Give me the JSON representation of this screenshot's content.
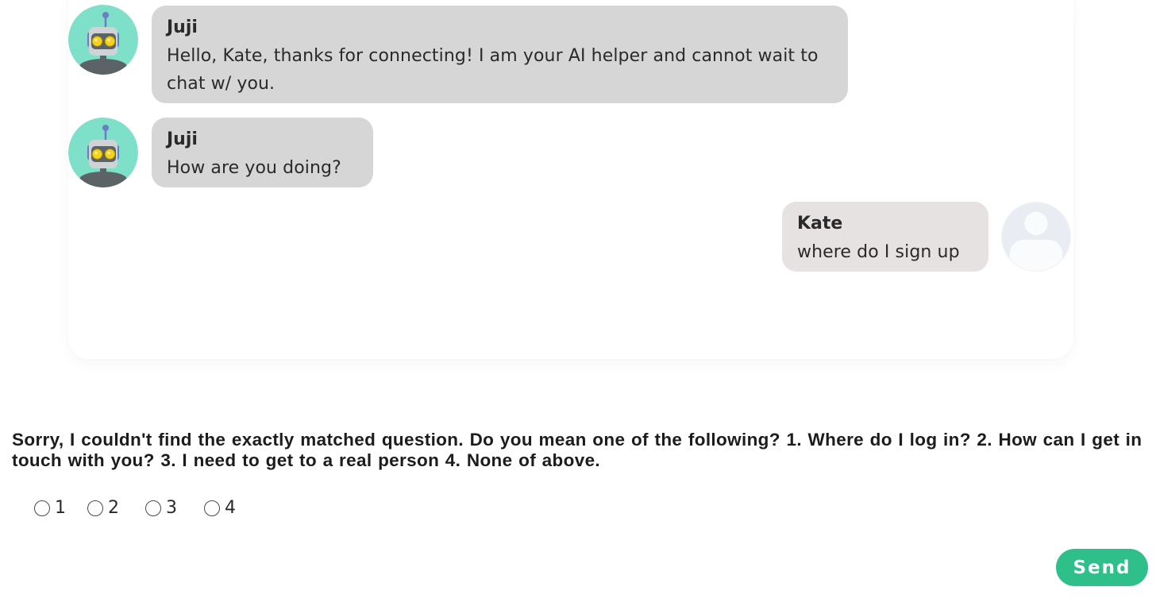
{
  "messages": [
    {
      "sender": "Juji",
      "text": "Hello, Kate, thanks for connecting! I am your AI helper and cannot wait to chat w/ you.",
      "avatar_icon": "robot-avatar-icon"
    },
    {
      "sender": "Juji",
      "text": "How are you doing?",
      "avatar_icon": "robot-avatar-icon"
    },
    {
      "sender": "Kate",
      "text": "where do I sign up",
      "avatar_icon": "user-silhouette-icon"
    }
  ],
  "question": "Sorry, I couldn't find the exactly matched question. Do you mean one of the following? 1. Where do I log in? 2. How can I get in touch with you? 3. I need to get to a real person 4. None of above.",
  "options": [
    "1",
    "2",
    "3",
    "4"
  ],
  "send_label": "Send",
  "colors": {
    "bot_bubble": "#d6d6d6",
    "user_bubble": "#e6e2e2",
    "send_button": "#2fbf8a",
    "robot_background": "#7ee0c8"
  }
}
